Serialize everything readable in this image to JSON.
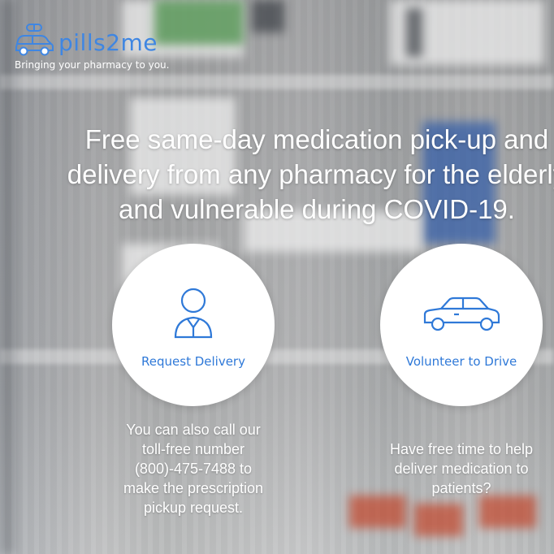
{
  "brand": {
    "name": "pills2me",
    "tagline": "Bringing your pharmacy to you.",
    "logo_icon": "car-with-pill-icon",
    "color": "#3f86e2"
  },
  "hero": {
    "headline_lines": [
      "Free same-day medication pick-up and",
      "delivery from any pharmacy for the elderly",
      "and vulnerable during COVID-19."
    ]
  },
  "actions": [
    {
      "label": "Request Delivery",
      "icon": "person-icon",
      "note_lines": [
        "You can also call our",
        "toll-free number",
        "(800)-475-7488 to",
        "make the prescription",
        "pickup request."
      ]
    },
    {
      "label": "Volunteer to Drive",
      "icon": "car-icon",
      "note_lines": [
        "Have free time to help",
        "deliver medication to",
        "patients?"
      ]
    }
  ],
  "colors": {
    "accent": "#2f79d8",
    "text_on_image": "#ffffff"
  }
}
